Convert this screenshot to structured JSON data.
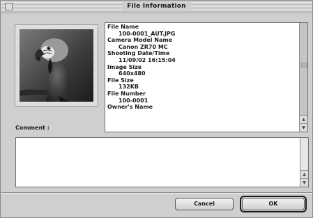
{
  "window": {
    "title": "File Information"
  },
  "image_preview": {
    "alt": "parrot-photo"
  },
  "info_list": [
    {
      "label": "File Name",
      "value": "100-0001_AUT.JPG"
    },
    {
      "label": "Camera Model Name",
      "value": "Canon ZR70 MC"
    },
    {
      "label": "Shooting Date/Time",
      "value": "11/09/02 16:15:04"
    },
    {
      "label": "Image Size",
      "value": "640x480"
    },
    {
      "label": "File Size",
      "value": "132KB"
    },
    {
      "label": "File Number",
      "value": "100-0001"
    },
    {
      "label": "Owner's Name",
      "value": ""
    }
  ],
  "comment": {
    "label": "Comment :",
    "value": ""
  },
  "buttons": {
    "cancel": "Cancel",
    "ok": "OK"
  },
  "icons": {
    "close": "close-box-icon",
    "scroll_up": "up-arrow-icon",
    "scroll_down": "down-arrow-icon"
  },
  "colors": {
    "window_bg": "#cfcfcf",
    "field_bg": "#ffffff",
    "border": "#6f6f6f"
  }
}
